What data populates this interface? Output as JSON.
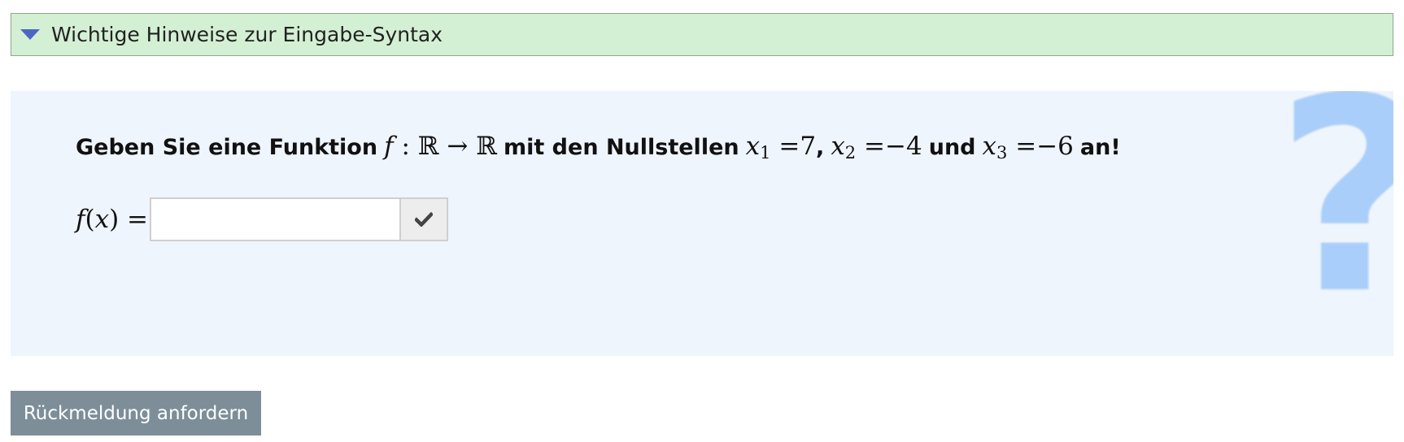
{
  "syntax_panel": {
    "title": "Wichtige Hinweise zur Eingabe-Syntax",
    "icon": "triangle-down-icon",
    "icon_color": "#4d67c0",
    "background_color": "#d4f0d4"
  },
  "question": {
    "background_color": "#eff5fd",
    "help_icon": "question-mark-icon",
    "help_icon_glyph": "?",
    "help_icon_color": "#a9cef9",
    "prompt_text_1": "Geben Sie eine Funktion",
    "function_name": "f",
    "colon": ":",
    "domain_set": "ℝ",
    "arrow": "→",
    "codomain_set": "ℝ",
    "prompt_text_2": "mit den Nullstellen",
    "roots": [
      {
        "var": "x",
        "index": "1",
        "equals": "=",
        "value": "7",
        "separator": ","
      },
      {
        "var": "x",
        "index": "2",
        "equals": "=",
        "value": "−4",
        "separator": ""
      },
      {
        "var": "x",
        "index": "3",
        "equals": "=",
        "value": "−6",
        "separator": ""
      }
    ],
    "conjunction": "und",
    "prompt_text_3": "an!",
    "answer_label": "f(x) =",
    "answer_value": "",
    "answer_placeholder": "",
    "check_icon": "check-icon",
    "check_icon_color": "#444444"
  },
  "actions": {
    "feedback_label": "Rückmeldung anfordern",
    "feedback_color": "#7d8e99"
  }
}
